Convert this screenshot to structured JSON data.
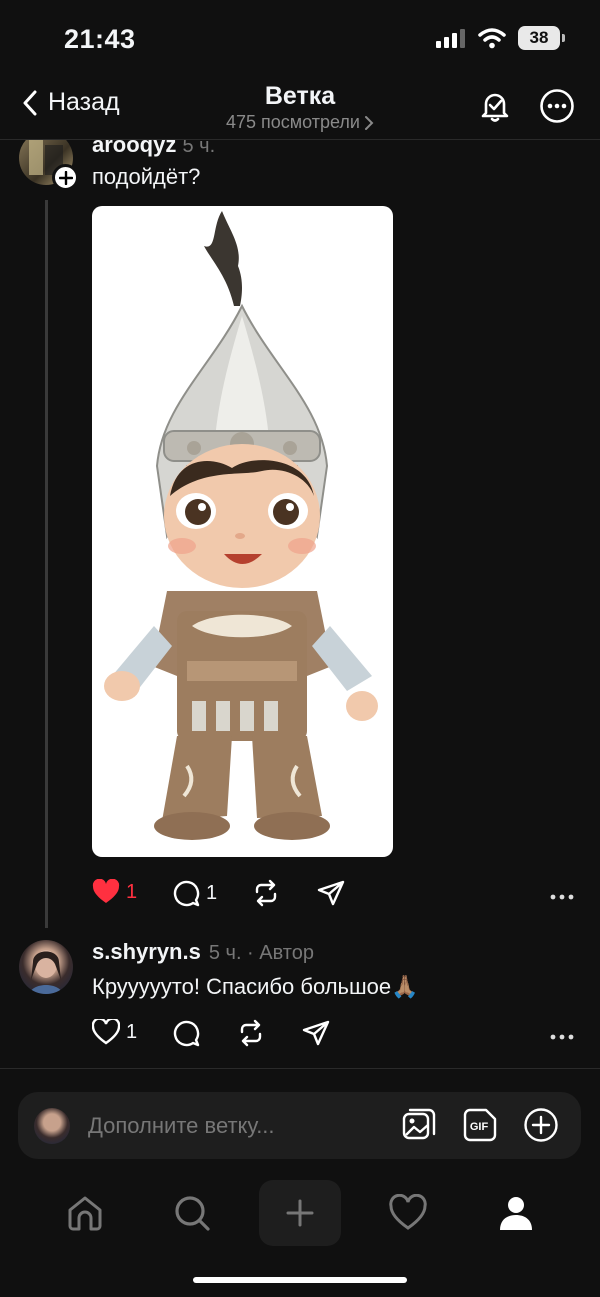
{
  "status_bar": {
    "time": "21:43",
    "battery": "38"
  },
  "header": {
    "back_label": "Назад",
    "title": "Ветка",
    "views": "475 посмотрели"
  },
  "post": {
    "username": "arooqyz",
    "time": "5 ч.",
    "text": "подойдёт?",
    "likes": "1",
    "replies": "1"
  },
  "reply": {
    "username": "s.shyryn.s",
    "meta": "5 ч. · Автор",
    "text": "Круууууто! Спасибо большое🙏🏽",
    "likes": "1"
  },
  "composer": {
    "placeholder": "Дополните ветку..."
  },
  "colors": {
    "background": "#101010",
    "accent_like": "#ff3040",
    "muted": "#777777"
  },
  "icons": [
    "back-chevron-icon",
    "bell-check-icon",
    "more-icon",
    "heart-icon",
    "comment-icon",
    "repost-icon",
    "share-icon",
    "gallery-icon",
    "gif-icon",
    "plus-circle-icon",
    "home-icon",
    "search-icon",
    "create-icon",
    "activity-icon",
    "profile-icon"
  ]
}
